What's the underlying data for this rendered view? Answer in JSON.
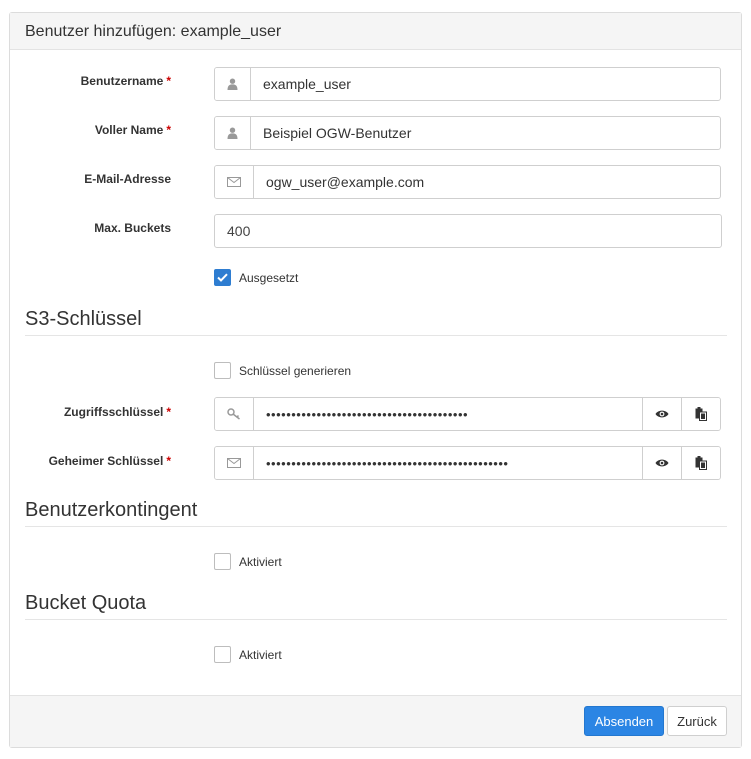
{
  "panel": {
    "title": "Benutzer hinzufügen: example_user"
  },
  "form": {
    "username": {
      "label": "Benutzername",
      "required": "*",
      "value": "example_user",
      "icon": "user-icon"
    },
    "fullname": {
      "label": "Voller Name",
      "required": "*",
      "value": "Beispiel OGW-Benutzer",
      "icon": "user-icon"
    },
    "email": {
      "label": "E-Mail-Adresse",
      "value": "ogw_user@example.com",
      "icon": "envelope-icon"
    },
    "max_buckets": {
      "label": "Max. Buckets",
      "value": "400"
    },
    "suspended": {
      "label": "Ausgesetzt",
      "checked": true
    }
  },
  "s3": {
    "title": "S3-Schlüssel",
    "generate": {
      "label": "Schlüssel generieren",
      "checked": false
    },
    "access_key": {
      "label": "Zugriffsschlüssel",
      "required": "*",
      "value": "••••••••••••••••••••••••••••••••••••••••",
      "icon": "key-icon"
    },
    "secret_key": {
      "label": "Geheimer Schlüssel",
      "required": "*",
      "value": "••••••••••••••••••••••••••••••••••••••••••••••••",
      "icon": "envelope-icon"
    }
  },
  "user_quota": {
    "title": "Benutzerkontingent",
    "enabled": {
      "label": "Aktiviert",
      "checked": false
    }
  },
  "bucket_quota": {
    "title": "Bucket Quota",
    "enabled": {
      "label": "Aktiviert",
      "checked": false
    }
  },
  "footer": {
    "submit_label": "Absenden",
    "back_label": "Zurück"
  },
  "colors": {
    "primary": "#2b85e4",
    "required": "#cc0000",
    "checkbox_checked": "#2e7dd1"
  }
}
